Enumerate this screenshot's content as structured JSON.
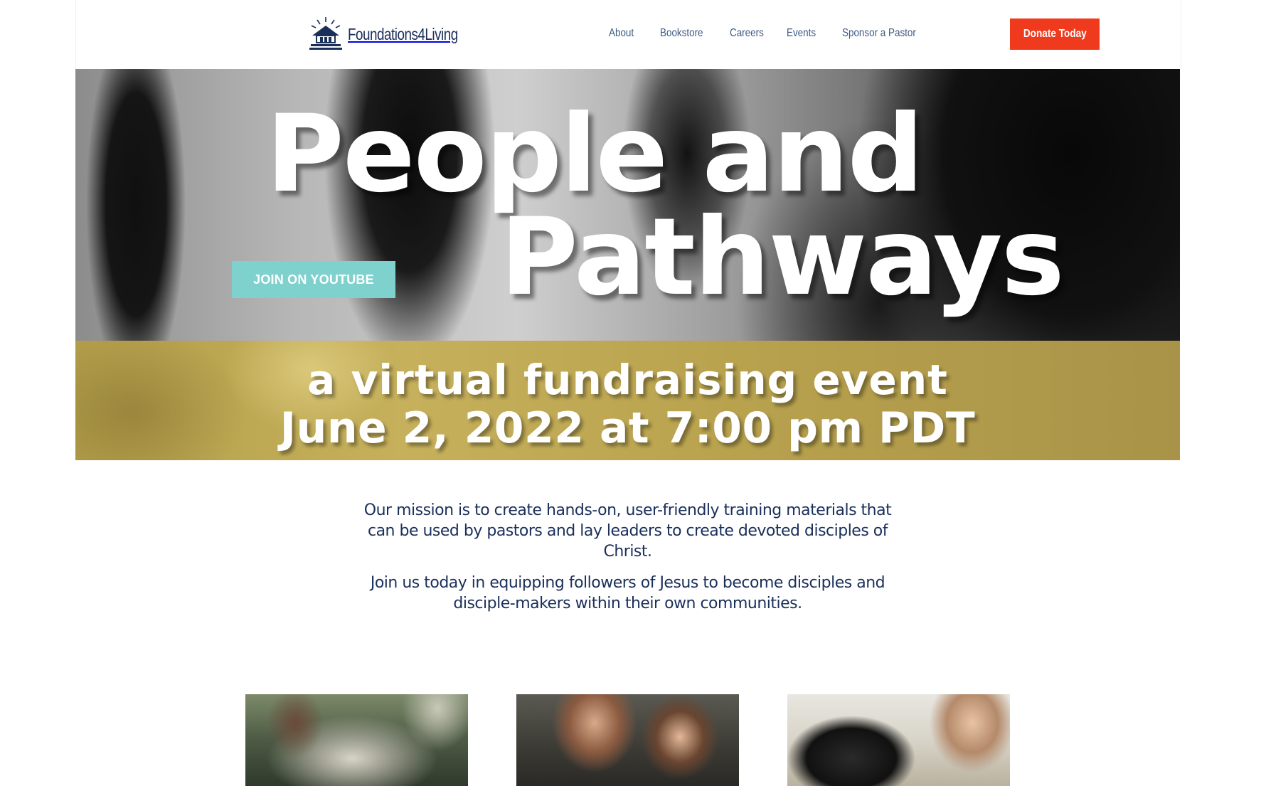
{
  "header": {
    "logo_text": "Foundations4Living",
    "nav": [
      {
        "label": "About"
      },
      {
        "label": "Bookstore"
      },
      {
        "label": "Careers"
      },
      {
        "label": "Events"
      },
      {
        "label": "Sponsor a Pastor"
      }
    ],
    "donate_label": "Donate Today"
  },
  "hero": {
    "title_line1": "People and",
    "title_line2": "Pathways",
    "subtitle_line1": "a virtual fundraising event",
    "subtitle_line2": "June 2, 2022 at 7:00 pm PDT",
    "youtube_button": "JOIN ON YOUTUBE"
  },
  "mission": {
    "paragraph1": "Our mission is to create hands-on, user-friendly training materials that can be used by pastors and lay leaders to create devoted disciples of Christ.",
    "paragraph2": "Join us today in equipping followers of Jesus to become disciples and disciple-makers within their own communities."
  },
  "colors": {
    "brand_navy": "#1a2f5a",
    "nav_link": "#3d5a84",
    "donate_red": "#f03a1e",
    "youtube_teal": "#7fd1ce",
    "band_gold": "#bba653"
  }
}
